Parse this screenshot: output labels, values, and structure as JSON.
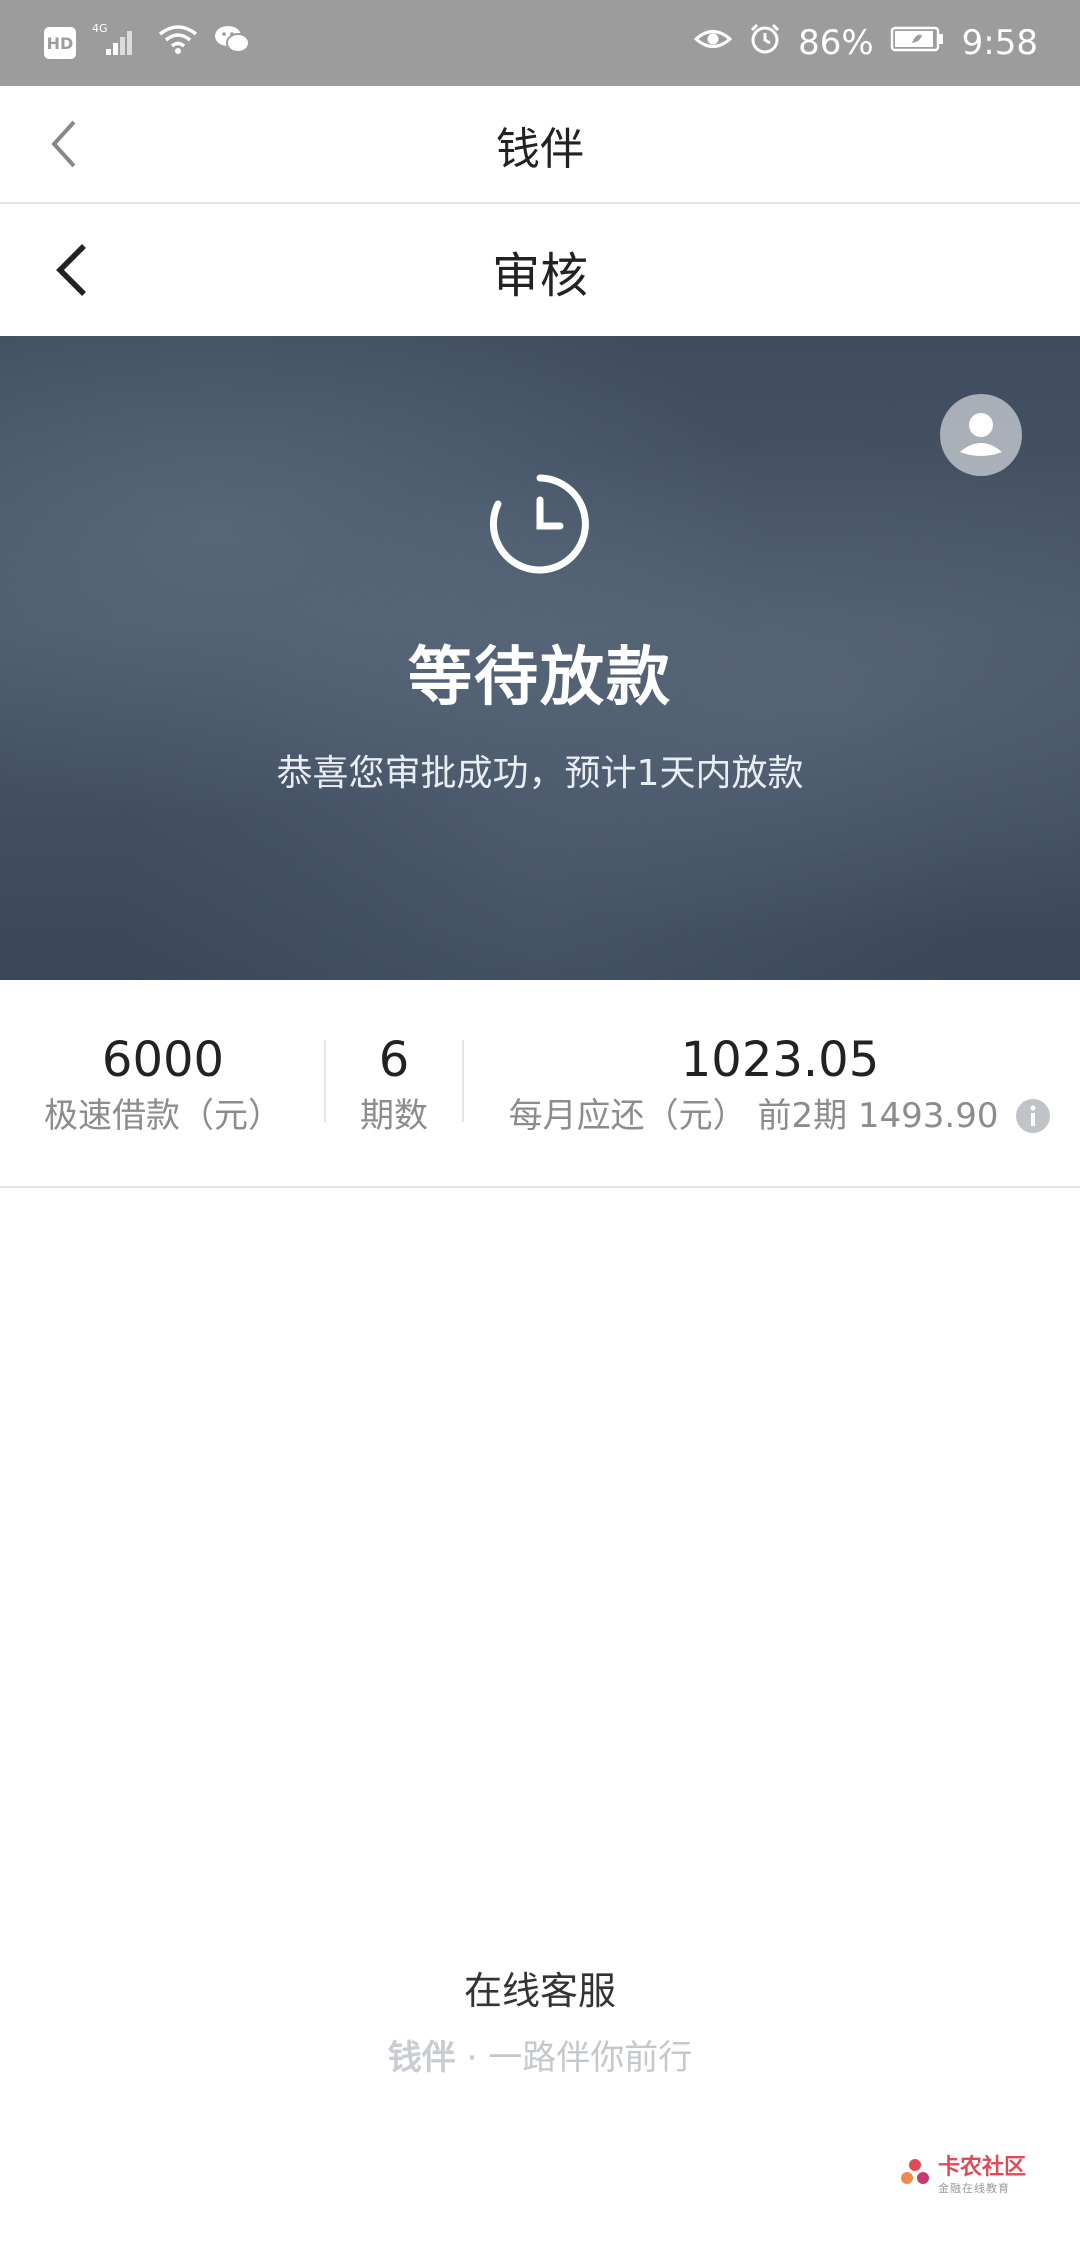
{
  "status_bar": {
    "hd": "HD",
    "network": "4G",
    "battery_percent": "86%",
    "time": "9:58"
  },
  "header_outer": {
    "title": "钱伴"
  },
  "header_inner": {
    "title": "审核"
  },
  "hero": {
    "status_title": "等待放款",
    "status_desc": "恭喜您审批成功，预计1天内放款"
  },
  "loan_summary": {
    "amount": {
      "value": "6000",
      "label": "极速借款（元）"
    },
    "periods": {
      "value": "6",
      "label": "期数"
    },
    "monthly": {
      "value": "1023.05",
      "label": "每月应还（元）",
      "note": "前2期 1493.90"
    }
  },
  "footer": {
    "service_link": "在线客服",
    "slogan_brand": "钱伴",
    "slogan_text": "· 一路伴你前行"
  },
  "watermark": {
    "main": "卡农社区",
    "sub": "金融在线教育"
  },
  "colors": {
    "status_bar": "#9c9c9c",
    "hero_bg": "#434f62",
    "muted_text": "#8c8c8c"
  }
}
